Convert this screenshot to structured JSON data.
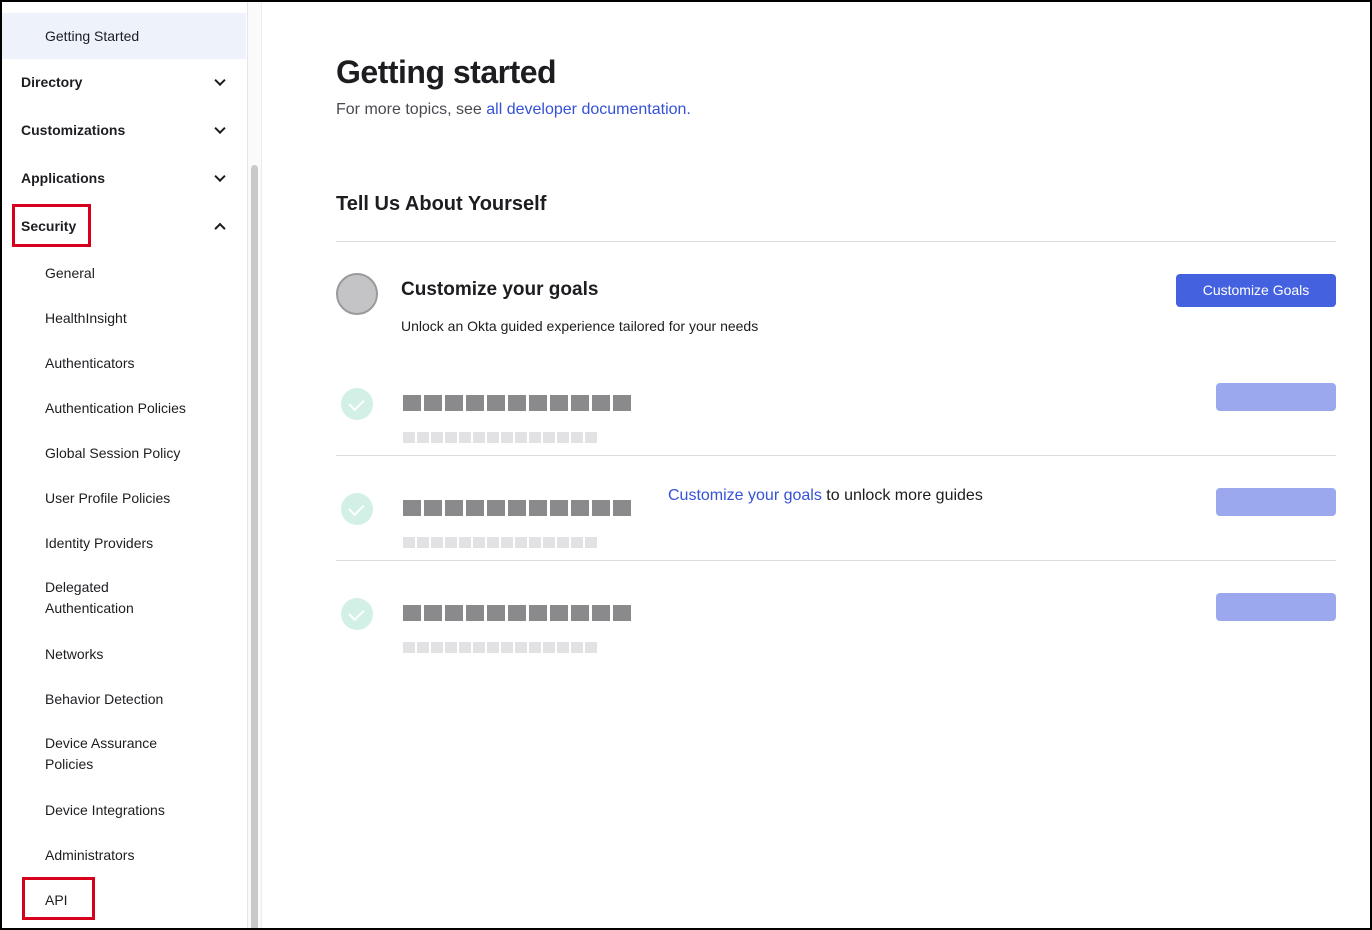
{
  "sidebar": {
    "getting_started": "Getting Started",
    "directory": "Directory",
    "customizations": "Customizations",
    "applications": "Applications",
    "security": "Security",
    "security_items": [
      "General",
      "HealthInsight",
      "Authenticators",
      "Authentication Policies",
      "Global Session Policy",
      "User Profile Policies",
      "Identity Providers",
      "Delegated",
      "Authentication",
      "Networks",
      "Behavior Detection",
      "Device Assurance",
      "Policies",
      "Device Integrations",
      "Administrators",
      "API"
    ]
  },
  "main": {
    "title": "Getting started",
    "subtitle_prefix": "For more topics, see ",
    "subtitle_link": "all developer documentation.",
    "section_title": "Tell Us About Yourself",
    "goal": {
      "title": "Customize your goals",
      "description": "Unlock an Okta guided experience tailored for your needs",
      "button": "Customize Goals"
    },
    "unlock": {
      "link": "Customize your goals",
      "suffix": " to unlock more guides"
    }
  },
  "colors": {
    "accent": "#4461e0",
    "link": "#3552d6",
    "highlight": "#d6001c",
    "check_bg": "#d3f0e6"
  }
}
